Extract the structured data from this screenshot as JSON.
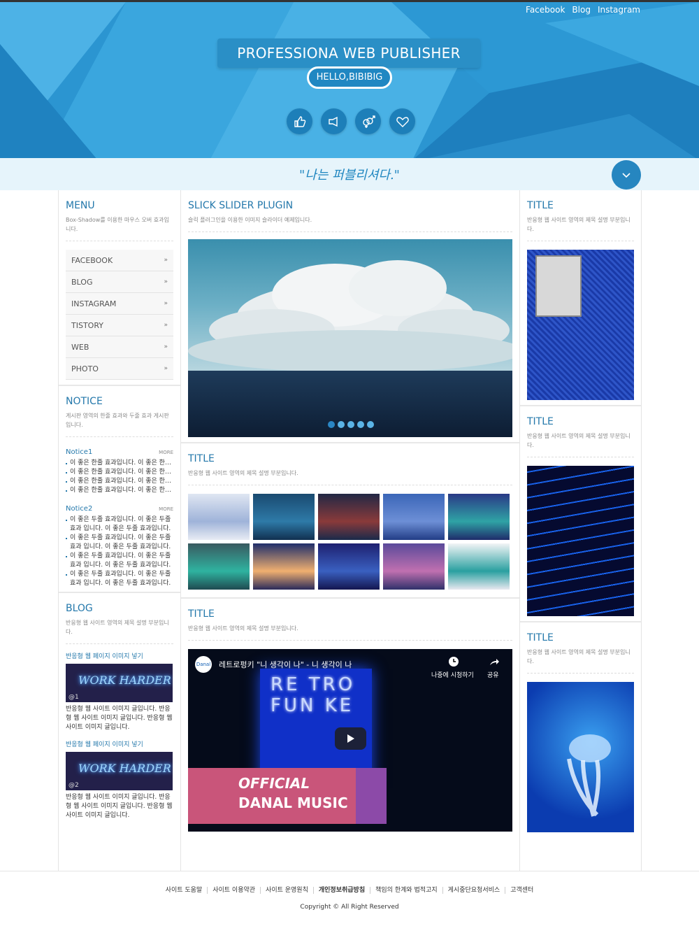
{
  "header": {
    "nav": [
      "Facebook",
      "Blog",
      "Instagram"
    ],
    "title": "PROFESSIONA WEB PUBLISHER",
    "hello": "HELLO,BIBIBIG",
    "icons": [
      "thumbs-up-icon",
      "thumbs-right-icon",
      "gender-icon",
      "heart-icon"
    ],
    "colors": {
      "primary": "#2a93cf",
      "accent": "#2478ab"
    }
  },
  "slogan": "\"나는 퍼블리셔다.\"",
  "menu": {
    "title": "MENU",
    "desc": "Box-Shadow를 이용한 마우스 오버 효과입니다.",
    "items": [
      "FACEBOOK",
      "BLOG",
      "INSTAGRAM",
      "TISTORY",
      "WEB",
      "PHOTO"
    ]
  },
  "notice": {
    "title": "NOTICE",
    "desc": "게시판 영역의 한줄 효과와 두줄 효과 게시판입니다.",
    "more": "MORE",
    "n1_title": "Notice1",
    "n1_items": [
      "이 좋은 한줄 효과입니다. 이 좋은 한줄 효과입니다.",
      "이 좋은 한줄 효과입니다. 이 좋은 한줄 효과입니다.",
      "이 좋은 한줄 효과입니다. 이 좋은 한줄 효과입니다.",
      "이 좋은 한줄 효과입니다. 이 좋은 한줄 효과입니다."
    ],
    "n2_title": "Notice2",
    "n2_items": [
      "이 좋은 두줄 효과입니다. 이 좋은 두줄 효과 입니다. 이 좋은 두줄 효과입니다.",
      "이 좋은 두줄 효과입니다. 이 좋은 두줄 효과 입니다. 이 좋은 두줄 효과입니다.",
      "이 좋은 두줄 효과입니다. 이 좋은 두줄 효과 입니다. 이 좋은 두줄 효과입니다.",
      "이 좋은 두줄 효과입니다. 이 좋은 두줄 효과 입니다. 이 좋은 두줄 효과입니다."
    ]
  },
  "blog": {
    "title": "BLOG",
    "desc": "반응형 웹 사이트 영역의 제목 설명 부분입니다.",
    "post_title": "반응형 웹 페이지 이미지 넣기",
    "neon": "WORK HARDER",
    "num1": "@1",
    "num2": "@2",
    "post_text": "반응형 웹 사이트 이미지 글입니다. 반응형 웹 사이트 이미지 글입니다. 반응형 웹 사이트 이미지 글입니다."
  },
  "slider": {
    "title": "SLICK SLIDER PLUGIN",
    "desc": "슬릭 플러그인을 이용한 이미지 슬라이더 예제입니다."
  },
  "gallery": {
    "title": "TITLE",
    "desc": "반응형 웹 사이트 영역의 제목 설명 부분입니다."
  },
  "video": {
    "title": "TITLE",
    "desc": "반응형 웹 사이트 영역의 제목 설명 부분입니다.",
    "channel": "Danal",
    "video_title": "레트로펑키 \"니 생각이 나\" - 니 생각이 나",
    "watch_later": "나중에 시청하기",
    "share": "공유",
    "neon_lines": "RE TRO FUN KE",
    "official": "OFFICIAL",
    "danal_music": "DANAL MUSIC"
  },
  "side": {
    "title": "TITLE",
    "desc": "반응형 웹 사이트 영역의 제목 설명 부분입니다."
  },
  "footer": {
    "links": [
      "사이트 도움말",
      "사이트 이용약관",
      "사이트 운영원칙",
      "개인정보취급방침",
      "책임의 한계와 법적고지",
      "게시중단요청서비스",
      "고객센터"
    ],
    "copyright": "Copyright © All Right Reserved"
  }
}
